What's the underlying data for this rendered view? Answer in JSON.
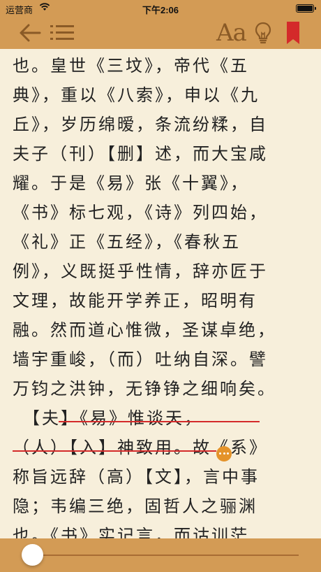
{
  "status_bar": {
    "carrier": "运营商",
    "time": "下午2:06"
  },
  "toolbar": {
    "back_icon": "arrow-left-icon",
    "toc_icon": "list-icon",
    "font_label": "Aa",
    "bulb_icon": "lightbulb-icon",
    "bookmark_icon": "bookmark-icon"
  },
  "content": {
    "lines": [
      "也。皇世《三坟》，帝代《五",
      "典》，重以《八索》，申以《九",
      "丘》，岁历绵暧，条流纷糅，自",
      "夫子（刊）【删】述，而大宝咸",
      "耀。于是《易》张《十翼》，",
      "《书》标七观，《诗》列四始，",
      "《礼》正《五经》，《春秋五",
      "例》，义既挺乎性情，辞亦匠于",
      "文理，故能开学养正，昭明有",
      "融。然而道心惟微，圣谋卓绝，",
      "墙宇重峻，（而）吐纳自深。譬",
      "万钧之洪钟，无铮铮之细响矣。",
      "　【夫】《易》惟谈天，",
      "（人）【入】神致用。故《系》",
      "称旨远辞（高）【文】，言中事",
      "隐；韦编三绝，固哲人之骊渊",
      "也。《书》实记言，而诂训茫"
    ],
    "highlight_color": "#d42a2a",
    "note_icon": "note-dots-icon"
  },
  "progress": {
    "value": 0.02
  },
  "colors": {
    "bar": "#d39b55",
    "page": "#f7efdb",
    "accent_icon": "#8a5a26",
    "bookmark": "#d42a2a"
  }
}
